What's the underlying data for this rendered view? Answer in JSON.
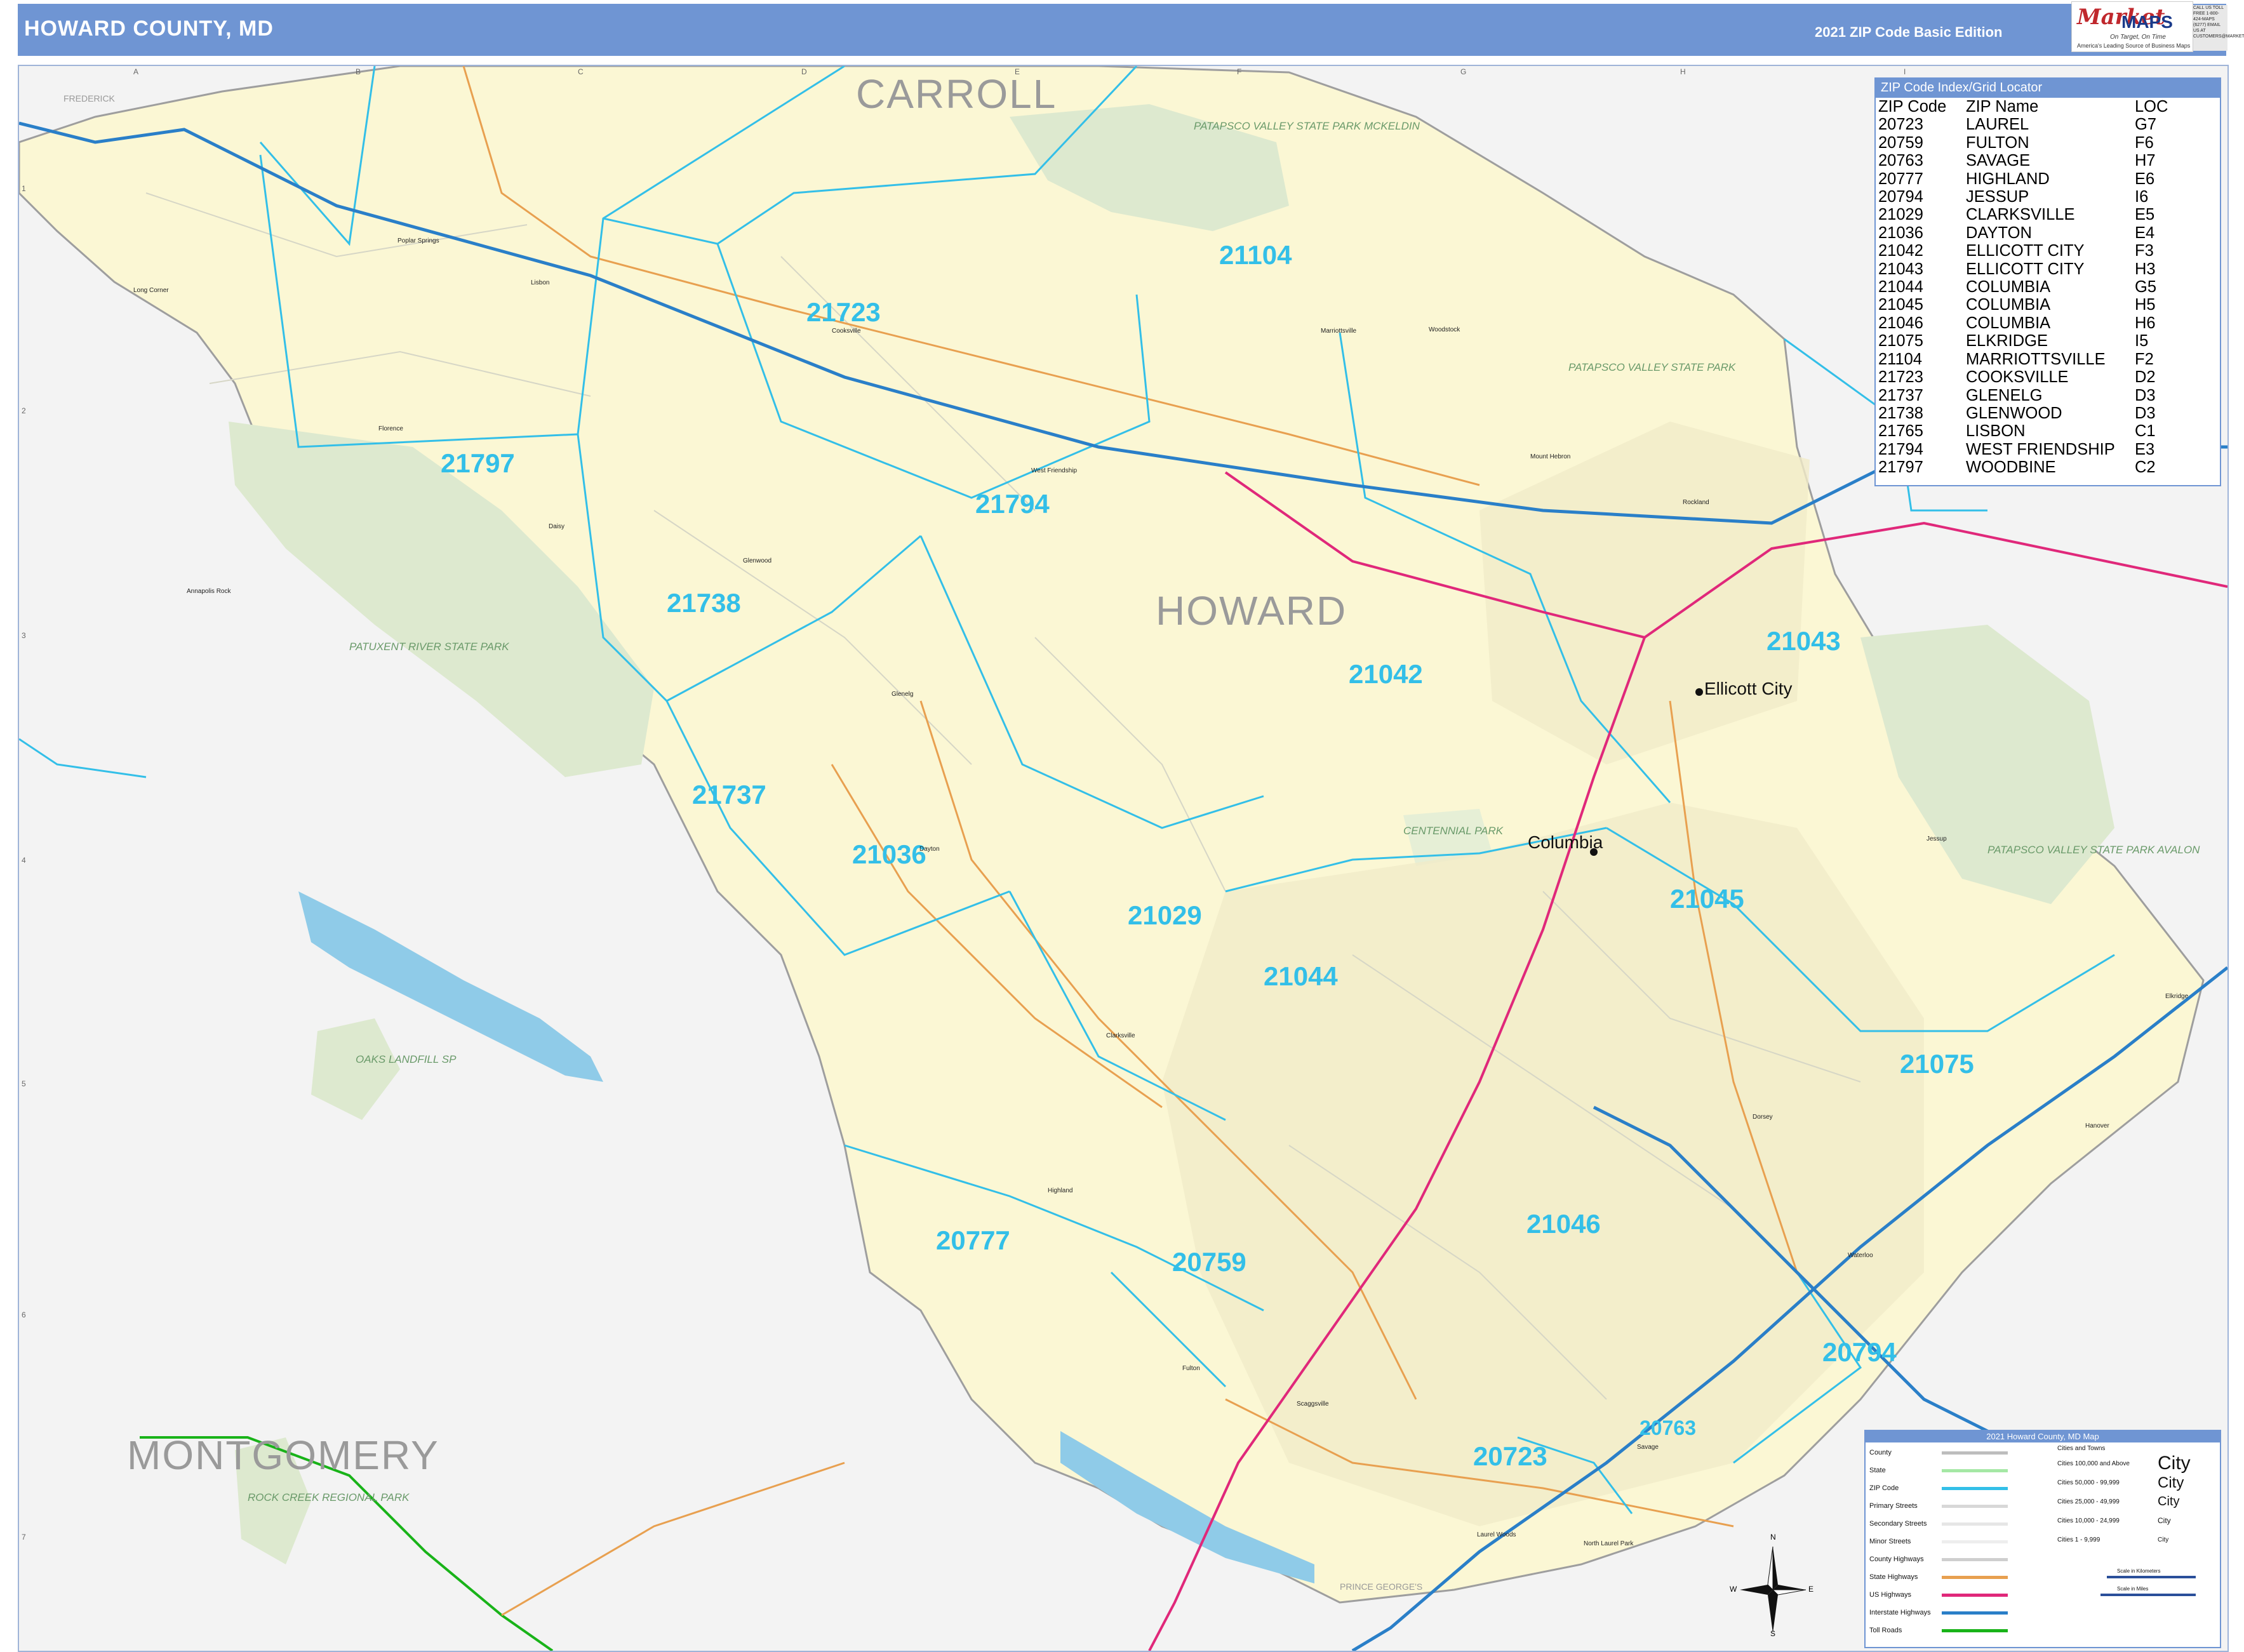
{
  "header": {
    "title": "HOWARD COUNTY, MD",
    "edition": "2021 ZIP Code Basic Edition",
    "logo_market": "Market",
    "logo_maps": "MAPS",
    "logo_tagline": "On Target, On Time",
    "logo_sub": "America's Leading Source of Business Maps",
    "phone_text": "CALL US TOLL FREE 1-800-424-MAPS (6277) EMAIL US AT CUSTOMERS@MARKETMAPS.COM"
  },
  "grid": {
    "columns": [
      "A",
      "B",
      "C",
      "D",
      "E",
      "F",
      "G",
      "H",
      "I"
    ],
    "rows": [
      "1",
      "2",
      "3",
      "4",
      "5",
      "6",
      "7"
    ]
  },
  "map": {
    "counties": {
      "carroll": "CARROLL",
      "howard": "HOWARD",
      "montgomery": "MONTGOMERY",
      "prince_georges": "PRINCE GEORGE'S",
      "frederick": "FREDERICK"
    },
    "zip_labels": [
      {
        "zip": "21104"
      },
      {
        "zip": "21723"
      },
      {
        "zip": "21797"
      },
      {
        "zip": "21794"
      },
      {
        "zip": "21738"
      },
      {
        "zip": "21042"
      },
      {
        "zip": "21043"
      },
      {
        "zip": "21737"
      },
      {
        "zip": "21036"
      },
      {
        "zip": "21029"
      },
      {
        "zip": "21044"
      },
      {
        "zip": "21045"
      },
      {
        "zip": "21075"
      },
      {
        "zip": "21046"
      },
      {
        "zip": "20777"
      },
      {
        "zip": "20759"
      },
      {
        "zip": "20794"
      },
      {
        "zip": "20763"
      },
      {
        "zip": "20723"
      }
    ],
    "cities": {
      "ellicott_city": "Ellicott City",
      "columbia": "Columbia"
    },
    "parks": {
      "patapsco_mckeldin": "PATAPSCO VALLEY STATE PARK MCKELDIN",
      "patapsco_top": "PATAPSCO VALLEY STATE PARK",
      "patuxent": "PATUXENT RIVER STATE PARK",
      "patapsco_avalon": "PATAPSCO VALLEY STATE PARK AVALON",
      "oaks_landfill": "OAKS LANDFILL SP",
      "rock_creek": "ROCK CREEK REGIONAL PARK",
      "centennial": "CENTENNIAL PARK"
    },
    "places": {
      "poplar_springs": "Poplar Springs",
      "long_corner": "Long Corner",
      "lisbon": "Lisbon",
      "cooksville": "Cooksville",
      "florence": "Florence",
      "daisy": "Daisy",
      "annapolis_rock": "Annapolis Rock",
      "glenwood": "Glenwood",
      "glenelg": "Glenelg",
      "dayton": "Dayton",
      "highland": "Highland",
      "clarksville": "Clarksville",
      "fulton": "Fulton",
      "scaggsville": "Scaggsville",
      "west_friendship": "West Friendship",
      "marriottsville": "Marriottsville",
      "woodstock": "Woodstock",
      "savage": "Savage",
      "elkridge": "Elkridge",
      "jessup": "Jessup",
      "laurel_woods": "Laurel Woods",
      "north_laurel": "North Laurel Park",
      "hanover": "Hanover",
      "waterloo": "Waterloo",
      "rockland": "Rockland",
      "mount_hebron": "Mount Hebron",
      "dorsey": "Dorsey"
    }
  },
  "index": {
    "title": "ZIP Code Index/Grid Locator",
    "headers": [
      "ZIP Code",
      "ZIP Name",
      "LOC"
    ],
    "rows": [
      [
        "20723",
        "LAUREL",
        "G7"
      ],
      [
        "20759",
        "FULTON",
        "F6"
      ],
      [
        "20763",
        "SAVAGE",
        "H7"
      ],
      [
        "20777",
        "HIGHLAND",
        "E6"
      ],
      [
        "20794",
        "JESSUP",
        "I6"
      ],
      [
        "21029",
        "CLARKSVILLE",
        "E5"
      ],
      [
        "21036",
        "DAYTON",
        "E4"
      ],
      [
        "21042",
        "ELLICOTT CITY",
        "F3"
      ],
      [
        "21043",
        "ELLICOTT CITY",
        "H3"
      ],
      [
        "21044",
        "COLUMBIA",
        "G5"
      ],
      [
        "21045",
        "COLUMBIA",
        "H5"
      ],
      [
        "21046",
        "COLUMBIA",
        "H6"
      ],
      [
        "21075",
        "ELKRIDGE",
        "I5"
      ],
      [
        "21104",
        "MARRIOTTSVILLE",
        "F2"
      ],
      [
        "21723",
        "COOKSVILLE",
        "D2"
      ],
      [
        "21737",
        "GLENELG",
        "D3"
      ],
      [
        "21738",
        "GLENWOOD",
        "D3"
      ],
      [
        "21765",
        "LISBON",
        "C1"
      ],
      [
        "21794",
        "WEST FRIENDSHIP",
        "E3"
      ],
      [
        "21797",
        "WOODBINE",
        "C2"
      ]
    ]
  },
  "legend": {
    "title": "2021 Howard County, MD Map",
    "cities_header": "Cities and Towns",
    "rows": [
      {
        "label": "County",
        "color": "#bdbdbd"
      },
      {
        "label": "State",
        "color": "#a5e8a5"
      },
      {
        "label": "ZIP Code",
        "color": "#33bfe8"
      },
      {
        "label": "Primary Streets",
        "color": "#d8d8d8"
      },
      {
        "label": "Secondary Streets",
        "color": "#e6e6e6"
      },
      {
        "label": "Minor Streets",
        "color": "#eeeeee"
      },
      {
        "label": "County Highways",
        "color": "#cfcfcf"
      },
      {
        "label": "State Highways",
        "color": "#e8a050"
      },
      {
        "label": "US Highways",
        "color": "#e0287a"
      },
      {
        "label": "Interstate Highways",
        "color": "#2a7fc8"
      },
      {
        "label": "Toll Roads",
        "color": "#19b319"
      }
    ],
    "city_classes": [
      {
        "label": "Cities 100,000 and Above",
        "sample": "City"
      },
      {
        "label": "Cities 50,000 - 99,999",
        "sample": "City"
      },
      {
        "label": "Cities 25,000 - 49,999",
        "sample": "City"
      },
      {
        "label": "Cities 10,000 - 24,999",
        "sample": "City"
      },
      {
        "label": "Cities 1 - 9,999",
        "sample": "City"
      }
    ],
    "scale_km": "Scale in Kilometers",
    "scale_mi": "Scale in Miles"
  },
  "compass": {
    "n": "N",
    "s": "S",
    "e": "E",
    "w": "W"
  },
  "colors": {
    "header": "#6f95d3",
    "county_fill": "#fbf7d4",
    "surrounding": "#f3f3f3",
    "park": "#dde9cf",
    "zip_boundary": "#33bfe8",
    "interstate": "#2a7fc8",
    "us_highway": "#e0287a",
    "state_highway": "#e8a050",
    "water": "#8fcbe8",
    "toll": "#19b319"
  }
}
